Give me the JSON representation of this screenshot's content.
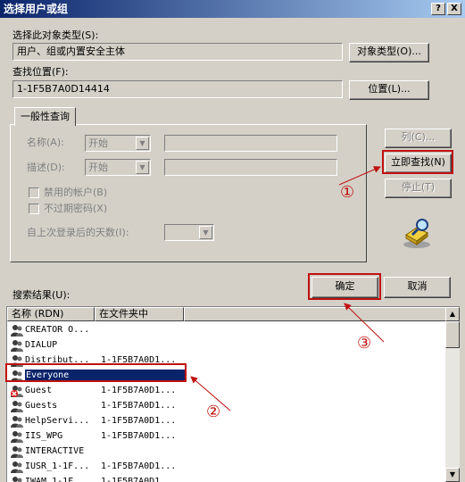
{
  "window": {
    "title": "选择用户或组",
    "help_btn": "?",
    "close_btn": "X"
  },
  "object_type": {
    "label": "选择此对象类型(S):",
    "value": "用户、组或内置安全主体",
    "button": "对象类型(O)..."
  },
  "location": {
    "label": "查找位置(F):",
    "value": "1-1F5B7A0D14414",
    "button": "位置(L)..."
  },
  "query": {
    "tab": "一般性查询",
    "name_label": "名称(A):",
    "name_mode": "开始",
    "desc_label": "描述(D):",
    "desc_mode": "开始",
    "disabled_accounts": "禁用的帐户(B)",
    "no_expire_pw": "不过期密码(X)",
    "days_label": "自上次登录后的天数(I):",
    "combo_arrow": "▼"
  },
  "actions": {
    "columns": "列(C)...",
    "find_now": "立即查找(N)",
    "stop": "停止(T)",
    "ok": "确定",
    "cancel": "取消"
  },
  "results": {
    "label": "搜索结果(U):",
    "columns": [
      "名称 (RDN)",
      "在文件夹中"
    ],
    "rows": [
      {
        "name": "CREATOR O...",
        "folder": ""
      },
      {
        "name": "DIALUP",
        "folder": ""
      },
      {
        "name": "Distribut...",
        "folder": "1-1F5B7A0D1..."
      },
      {
        "name": "Everyone",
        "folder": ""
      },
      {
        "name": "Guest",
        "folder": "1-1F5B7A0D1..."
      },
      {
        "name": "Guests",
        "folder": "1-1F5B7A0D1..."
      },
      {
        "name": "HelpServi...",
        "folder": "1-1F5B7A0D1..."
      },
      {
        "name": "IIS_WPG",
        "folder": "1-1F5B7A0D1..."
      },
      {
        "name": "INTERACTIVE",
        "folder": ""
      },
      {
        "name": "IUSR_1-1F...",
        "folder": "1-1F5B7A0D1..."
      },
      {
        "name": "IWAM_1-1F...",
        "folder": "1-1F5B7A0D1..."
      }
    ],
    "selected_index": 3,
    "scroll_up": "▲",
    "scroll_down": "▼"
  },
  "annotations": {
    "step1": "①",
    "step2": "②",
    "step3": "③",
    "color": "#c01010"
  }
}
